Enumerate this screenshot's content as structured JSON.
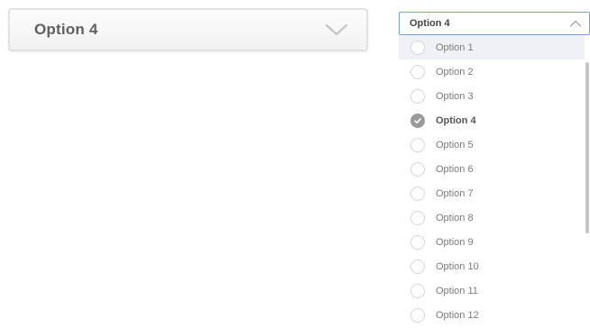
{
  "closed_select": {
    "value": "Option 4",
    "icon": "chevron-down-icon"
  },
  "open_select": {
    "value": "Option 4",
    "icon": "chevron-up-icon",
    "options": [
      {
        "label": "Option 1",
        "checked": false
      },
      {
        "label": "Option 2",
        "checked": false
      },
      {
        "label": "Option 3",
        "checked": false
      },
      {
        "label": "Option 4",
        "checked": true
      },
      {
        "label": "Option 5",
        "checked": false
      },
      {
        "label": "Option 6",
        "checked": false
      },
      {
        "label": "Option 7",
        "checked": false
      },
      {
        "label": "Option 8",
        "checked": false
      },
      {
        "label": "Option 9",
        "checked": false
      },
      {
        "label": "Option 10",
        "checked": false
      },
      {
        "label": "Option 11",
        "checked": false
      },
      {
        "label": "Option 12",
        "checked": false
      }
    ]
  },
  "colors": {
    "border": "#e2e2e2",
    "focus_border": "#7ca3c9",
    "hover_bg": "#eef1f5",
    "check_fill": "#9a9a9a"
  }
}
